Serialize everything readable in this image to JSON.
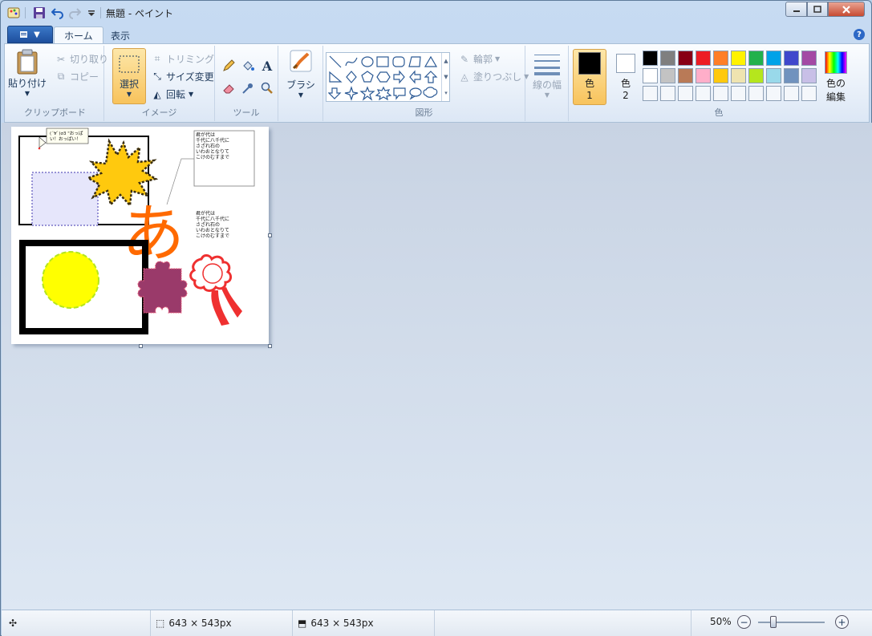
{
  "window": {
    "title": "無題 - ペイント"
  },
  "tabs": [
    {
      "label": "ホーム"
    },
    {
      "label": "表示"
    }
  ],
  "clipboard": {
    "paste": "貼り付け",
    "cut": "切り取り",
    "copy": "コピー",
    "group": "クリップボード"
  },
  "image": {
    "select": "選択",
    "crop": "トリミング",
    "resize": "サイズ変更",
    "rotate": "回転",
    "group": "イメージ"
  },
  "tools": {
    "group": "ツール"
  },
  "brushes": {
    "label": "ブラシ"
  },
  "shapes": {
    "outline": "輪郭",
    "fill": "塗りつぶし",
    "group": "図形"
  },
  "size": {
    "label": "線の幅"
  },
  "colors": {
    "color1_a": "色",
    "color1_b": "1",
    "color2_a": "色",
    "color2_b": "2",
    "edit_a": "色の",
    "edit_b": "編集",
    "group": "色",
    "color1": "#000000",
    "color2": "#ffffff",
    "palette_row1": [
      "#000000",
      "#7f7f7f",
      "#880015",
      "#ed1c24",
      "#ff7f27",
      "#fff200",
      "#22b14c",
      "#00a2e8",
      "#3f48cc",
      "#a349a4"
    ],
    "palette_row2": [
      "#ffffff",
      "#c3c3c3",
      "#b97a57",
      "#ffaec9",
      "#ffc90e",
      "#efe4b0",
      "#b5e61d",
      "#99d9ea",
      "#7092be",
      "#c8bfe7"
    ]
  },
  "canvas": {
    "callout_text": [
      "(´∀`)σ3 \"おっぱ",
      "い！おっぱい！"
    ],
    "text_block_1": [
      "君が代は",
      "千代に八千代に",
      "さざれ石の",
      "いわおとなりて",
      "こけのむすまで"
    ],
    "text_block_2": [
      "君が代は",
      "千代に八千代に",
      "さざれ石の",
      "いわおとなりて",
      "こけのむすまで"
    ],
    "hiragana": "あ"
  },
  "status": {
    "selection_size": "643 × 543px",
    "image_size": "643 × 543px",
    "zoom": "50%"
  }
}
